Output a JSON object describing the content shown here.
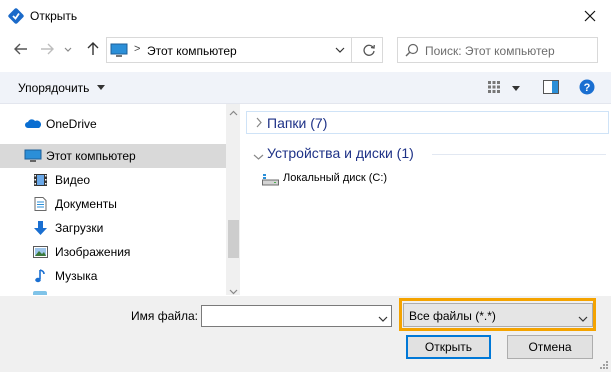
{
  "window": {
    "title": "Открыть"
  },
  "nav": {
    "back_icon": "arrow-left-icon",
    "forward_icon": "arrow-right-icon",
    "recent_icon": "chevron-down-icon",
    "up_icon": "arrow-up-icon"
  },
  "address": {
    "location": "Этот компьютер",
    "separator": ">"
  },
  "search": {
    "placeholder": "Поиск: Этот компьютер"
  },
  "toolbar": {
    "organize_label": "Упорядочить"
  },
  "sidebar": {
    "items": [
      {
        "label": "OneDrive",
        "icon": "cloud-icon"
      },
      {
        "label": "Этот компьютер",
        "icon": "computer-icon",
        "selected": true
      },
      {
        "label": "Видео",
        "icon": "video-icon"
      },
      {
        "label": "Документы",
        "icon": "document-icon"
      },
      {
        "label": "Загрузки",
        "icon": "download-icon"
      },
      {
        "label": "Изображения",
        "icon": "image-icon"
      },
      {
        "label": "Музыка",
        "icon": "music-icon"
      }
    ]
  },
  "content": {
    "folders_group": "Папки (7)",
    "devices_group": "Устройства и диски (1)",
    "drives": [
      {
        "label": "Локальный диск (C:)"
      }
    ]
  },
  "footer": {
    "filename_label": "Имя файла:",
    "filename_value": "",
    "filter_value": "Все файлы (*.*)",
    "open_label": "Открыть",
    "cancel_label": "Отмена"
  },
  "colors": {
    "highlight": "#f4a300",
    "accent": "#0078d7",
    "group_header": "#1e3287"
  }
}
